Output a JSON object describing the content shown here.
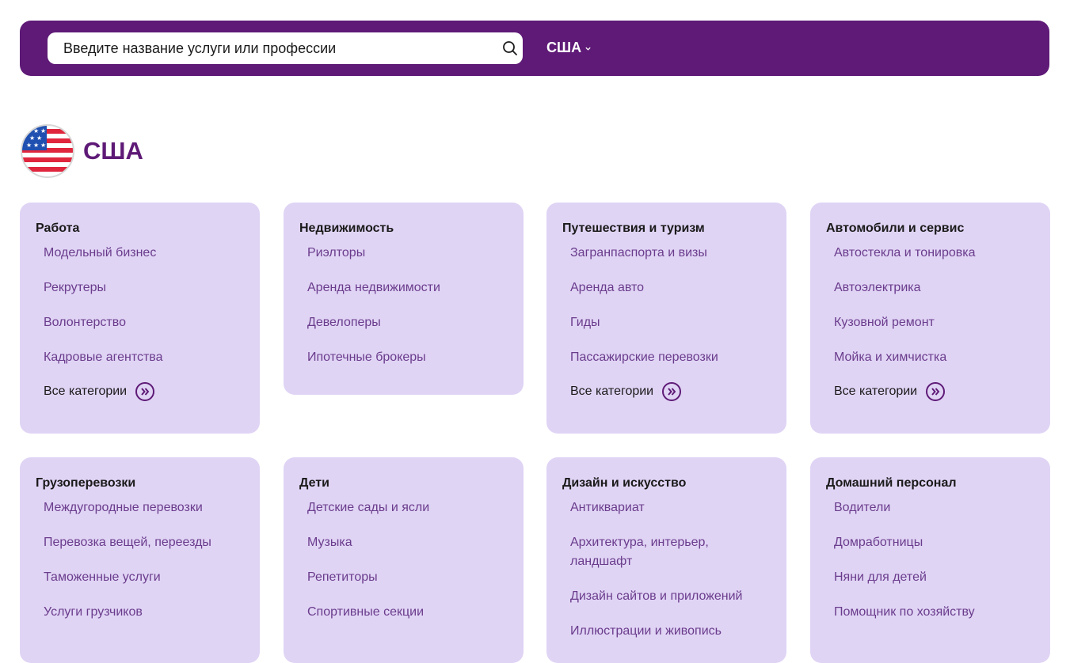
{
  "header": {
    "search_placeholder": "Введите название услуги или профессии",
    "search_icon": "search-icon",
    "country_selector": "США"
  },
  "page": {
    "title": "США",
    "flag": "us-flag-icon"
  },
  "colors": {
    "brand": "#5e1a76",
    "card_bg": "#e0d4f5",
    "link": "#6a3c8c"
  },
  "more_label": "Все категории",
  "categories": [
    {
      "title": "Работа",
      "items": [
        "Модельный бизнес",
        "Рекрутеры",
        "Волонтерство",
        "Кадровые агентства"
      ],
      "has_more": true
    },
    {
      "title": "Недвижимость",
      "items": [
        "Риэлторы",
        "Аренда недвижимости",
        "Девелоперы",
        "Ипотечные брокеры"
      ],
      "has_more": false
    },
    {
      "title": "Путешествия и туризм",
      "items": [
        "Загранпаспорта и визы",
        "Аренда авто",
        "Гиды",
        "Пассажирские перевозки"
      ],
      "has_more": true
    },
    {
      "title": "Автомобили и сервис",
      "items": [
        "Автостекла и тонировка",
        "Автоэлектрика",
        "Кузовной ремонт",
        "Мойка и химчистка"
      ],
      "has_more": true
    },
    {
      "title": "Грузоперевозки",
      "items": [
        "Междугородные перевозки",
        "Перевозка вещей, переезды",
        "Таможенные услуги",
        "Услуги грузчиков"
      ],
      "has_more": false
    },
    {
      "title": "Дети",
      "items": [
        "Детские сады и ясли",
        "Музыка",
        "Репетиторы",
        "Спортивные секции"
      ],
      "has_more": false
    },
    {
      "title": "Дизайн и искусство",
      "items": [
        "Антиквариат",
        "Архитектура, интерьер, ландшафт",
        "Дизайн сайтов и приложений",
        "Иллюстрации и живопись"
      ],
      "has_more": false
    },
    {
      "title": "Домашний персонал",
      "items": [
        "Водители",
        "Домработницы",
        "Няни для детей",
        "Помощник по хозяйству"
      ],
      "has_more": false
    }
  ]
}
